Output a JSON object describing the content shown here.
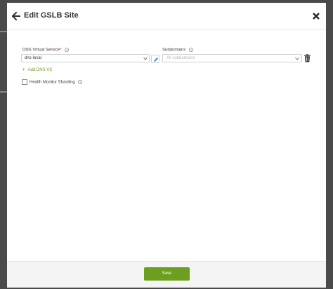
{
  "modal": {
    "title": "Edit GSLB Site",
    "back_icon": "arrow-left-icon",
    "close_icon": "close-icon"
  },
  "form": {
    "dns_vs_label": "DNS Virtual Service",
    "dns_vs_required_mark": "*",
    "dns_vs_value": "dns-local",
    "subdomains_label": "Subdomains",
    "subdomains_placeholder": "All subdomains",
    "add_dns_vs_label": "Add DNS VS",
    "add_icon": "plus-icon",
    "health_monitor_label": "Health Monitor Sharding",
    "health_monitor_checked": false,
    "edit_icon": "pencil-icon",
    "delete_icon": "trash-icon",
    "help_icon": "help-circle-icon"
  },
  "footer": {
    "save_label": "Save"
  },
  "colors": {
    "accent_green": "#6c9e1f",
    "link_green": "#6e9a1e",
    "required_red": "#d0021b"
  }
}
